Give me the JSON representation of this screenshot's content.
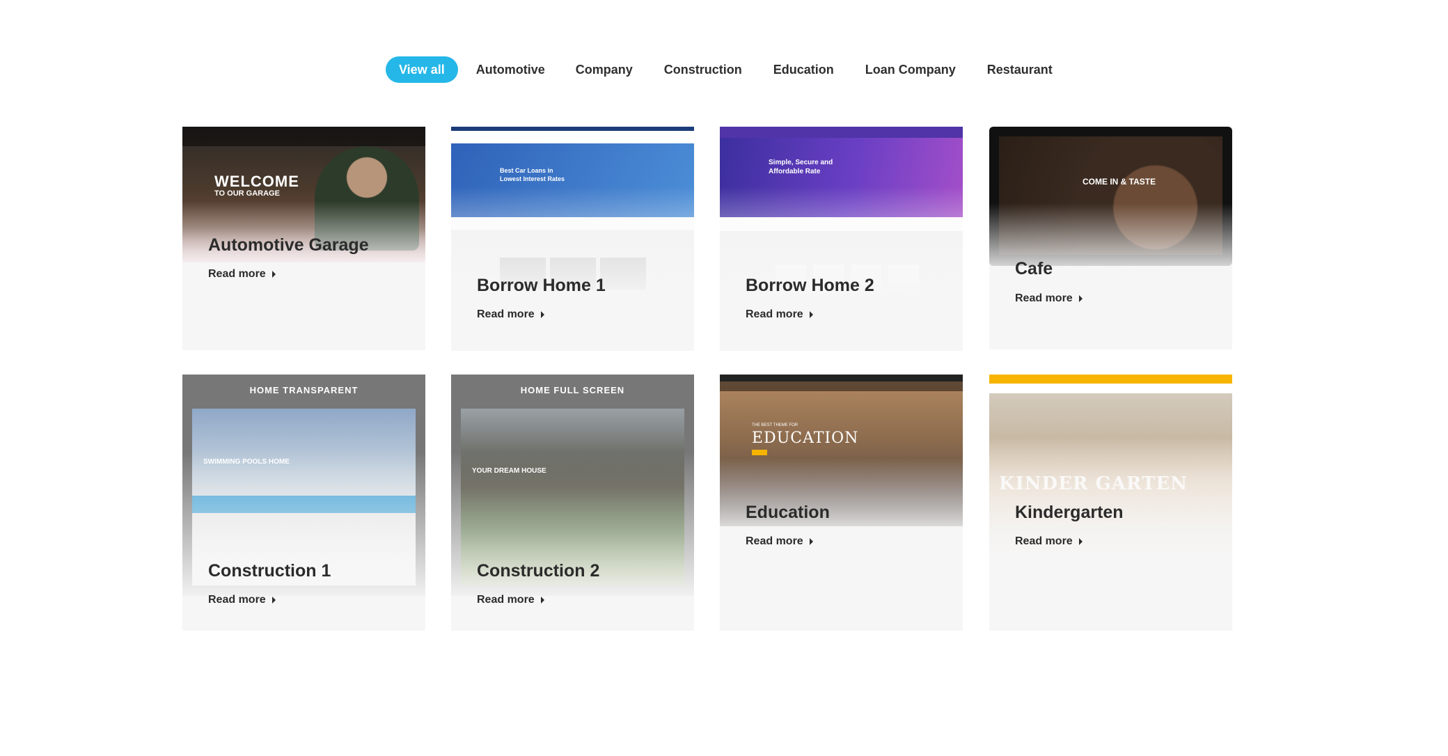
{
  "filters": {
    "view_all": "View all",
    "automotive": "Automotive",
    "company": "Company",
    "construction": "Construction",
    "education": "Education",
    "loan_company": "Loan Company",
    "restaurant": "Restaurant"
  },
  "read_more": "Read more",
  "cards": {
    "automotive_garage": {
      "title": "Automotive Garage",
      "thumb_heading": "WELCOME",
      "thumb_sub": "TO OUR GARAGE"
    },
    "borrow_home_1": {
      "title": "Borrow Home 1",
      "thumb_heading": "Best Car Loans in Lowest Interest Rates"
    },
    "borrow_home_2": {
      "title": "Borrow Home 2",
      "thumb_heading": "Simple, Secure and Affordable Rate"
    },
    "cafe": {
      "title": "Cafe",
      "thumb_heading": "COME IN & TASTE"
    },
    "construction_1": {
      "title": "Construction 1",
      "thumb_label": "HOME TRANSPARENT",
      "thumb_heading": "SWIMMING POOLS HOME"
    },
    "construction_2": {
      "title": "Construction 2",
      "thumb_label": "HOME FULL SCREEN",
      "thumb_heading": "YOUR DREAM HOUSE"
    },
    "education": {
      "title": "Education",
      "thumb_heading": "EDUCATION",
      "thumb_sub": "THE BEST THEME FOR"
    },
    "kindergarten": {
      "title": "Kindergarten",
      "thumb_heading": "KINDER GARTEN"
    }
  },
  "colors": {
    "accent": "#25b7e8",
    "card_bg": "#f6f6f6",
    "text": "#2b2b2b"
  }
}
